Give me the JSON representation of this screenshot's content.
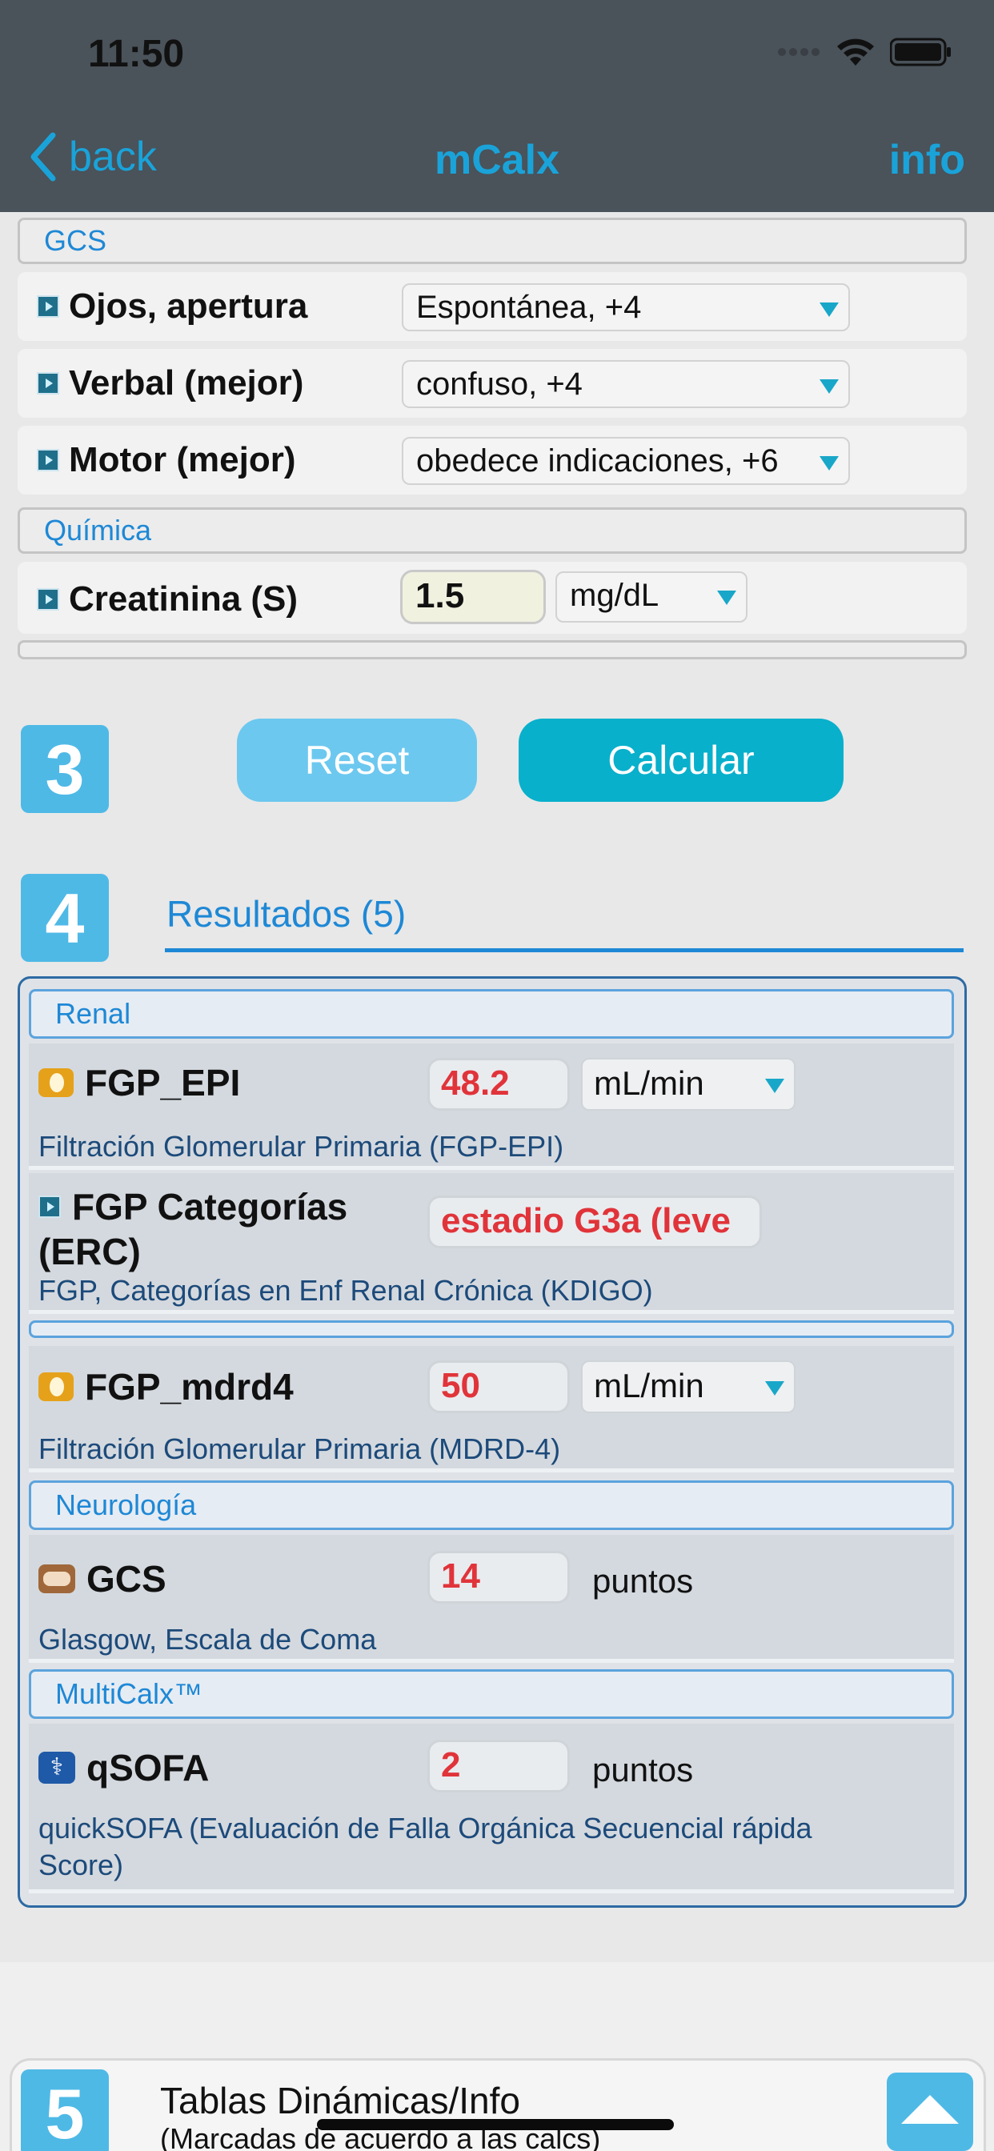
{
  "status": {
    "time": "11:50"
  },
  "nav": {
    "back": "back",
    "title": "mCalx",
    "info": "info"
  },
  "inputs": {
    "gcs_section": "GCS",
    "ojos": {
      "label": "Ojos, apertura",
      "value": "Espontánea, +4"
    },
    "verbal": {
      "label": "Verbal (mejor)",
      "value": "confuso, +4"
    },
    "motor": {
      "label": "Motor (mejor)",
      "value": "obedece indicaciones, +6"
    },
    "quimica_section": "Química",
    "creatinina": {
      "label": "Creatinina (S)",
      "value": "1.5",
      "unit": "mg/dL"
    }
  },
  "steps": {
    "s3": "3",
    "s4": "4",
    "s5": "5"
  },
  "buttons": {
    "reset": "Reset",
    "calc": "Calcular"
  },
  "results_tab": "Resultados (5)",
  "results": {
    "renal_section": "Renal",
    "fgp_epi": {
      "label": "FGP_EPI",
      "value": "48.2",
      "unit": "mL/min",
      "desc": "Filtración Glomerular Primaria (FGP-EPI)"
    },
    "fgp_cat": {
      "label_line1": "FGP Categorías",
      "label_line2": "(ERC)",
      "value": "estadio G3a (leve",
      "desc": "FGP, Categorías en Enf Renal Crónica (KDIGO)"
    },
    "fgp_mdrd4": {
      "label": "FGP_mdrd4",
      "value": "50",
      "unit": "mL/min",
      "desc": "Filtración Glomerular Primaria (MDRD-4)"
    },
    "neuro_section": "Neurología",
    "gcs": {
      "label": "GCS",
      "value": "14",
      "unit": "puntos",
      "desc": "Glasgow, Escala de Coma"
    },
    "multi_section": "MultiCalx™",
    "qsofa": {
      "label": "qSOFA",
      "value": "2",
      "unit": "puntos",
      "desc_line1": "quickSOFA (Evaluación de Falla Orgánica Secuencial rápida",
      "desc_line2": "Score)"
    }
  },
  "footer": {
    "title": "Tablas Dinámicas/Info",
    "subtitle": "(Marcadas de acuerdo a las calcs)"
  },
  "colors": {
    "accent": "#1e88d6",
    "nav_bg": "#4a525a",
    "result_red": "#e0343a",
    "calc_btn": "#08b0cc"
  }
}
